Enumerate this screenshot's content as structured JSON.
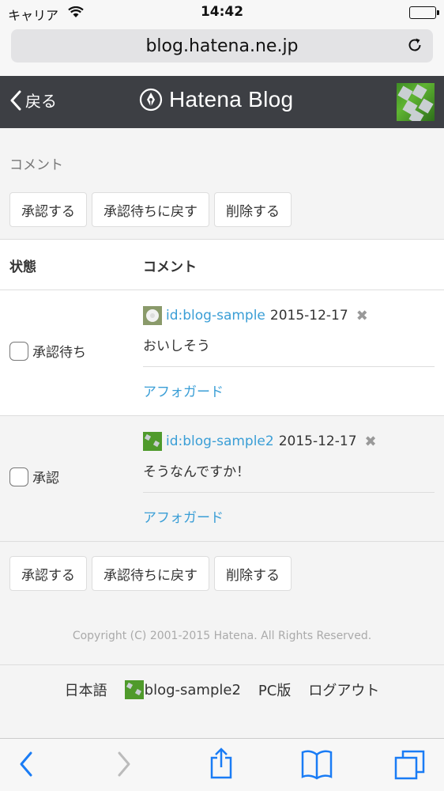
{
  "status": {
    "carrier": "キャリア",
    "time": "14:42"
  },
  "browser": {
    "url": "blog.hatena.ne.jp"
  },
  "header": {
    "back_label": "戻る",
    "logo_text": "Hatena Blog"
  },
  "page": {
    "section_title": "コメント"
  },
  "actions": {
    "approve": "承認する",
    "revert": "承認待ちに戻す",
    "delete": "削除する"
  },
  "table": {
    "col_status": "状態",
    "col_comment": "コメント",
    "rows": [
      {
        "status": "承認待ち",
        "user": "id:blog-sample",
        "date": "2015-12-17",
        "delete_mark": "✖",
        "text": "おいしそう",
        "entry": "アフォガード"
      },
      {
        "status": "承認",
        "user": "id:blog-sample2",
        "date": "2015-12-17",
        "delete_mark": "✖",
        "text": "そうなんですか！",
        "entry": "アフォガード"
      }
    ]
  },
  "copyright": "Copyright (C) 2001-2015 Hatena. All Rights Reserved.",
  "footer": {
    "language": "日本語",
    "username": "blog-sample2",
    "pc": "PC版",
    "logout": "ログアウト"
  },
  "toolbar": [
    "back-icon",
    "forward-icon",
    "share-icon",
    "bookmarks-icon",
    "tabs-icon"
  ],
  "colors": {
    "header_bg": "#3d3f44",
    "link": "#3a9ed6",
    "ios_blue": "#1a7cf5"
  }
}
